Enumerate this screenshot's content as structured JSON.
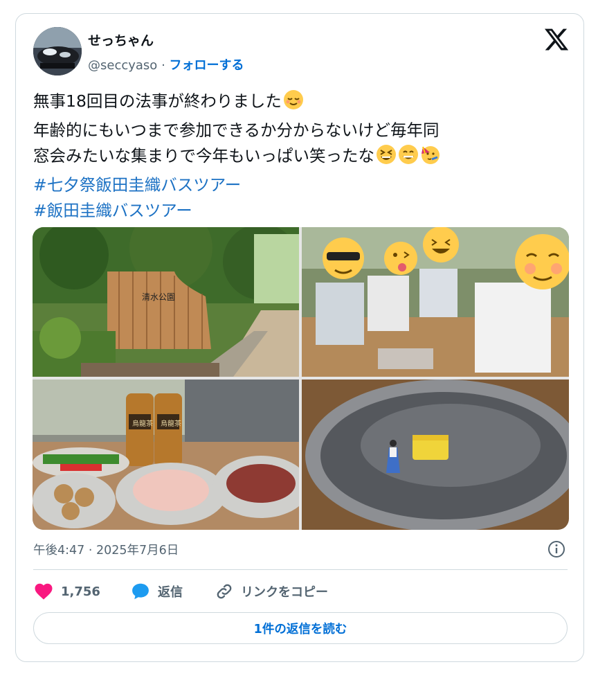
{
  "author": {
    "display_name": "せっちゃん",
    "handle": "@seccyaso",
    "separator": "·",
    "follow_label": "フォローする"
  },
  "tweet": {
    "line1": "無事18回目の法事が終わりました",
    "line2": "年齢的にもいつまで参加できるか分からないけど毎年同",
    "line3": "窓会みたいな集まりで今年もいっぱい笑ったな",
    "hashtag1": "#七夕祭飯田圭織バスツアー",
    "hashtag2": "#飯田圭織バスツアー",
    "emojis": [
      "relieved-face",
      "grinning-squinting-face",
      "beaming-face",
      "partying-face"
    ]
  },
  "photos": {
    "count": 4,
    "sign_text": "清水公園",
    "bottle_label": "烏龍茶"
  },
  "meta": {
    "timestamp": "午後4:47 · 2025年7月6日"
  },
  "actions": {
    "like_count": "1,756",
    "reply_label": "返信",
    "copy_link_label": "リンクをコピー"
  },
  "read_replies_label": "1件の返信を読む",
  "colors": {
    "link_blue": "#1d72c4",
    "follow_blue": "#006fd6",
    "like_pink": "#f91880",
    "reply_blue": "#1d9bf0",
    "muted": "#536471",
    "border": "#cfd9de"
  }
}
